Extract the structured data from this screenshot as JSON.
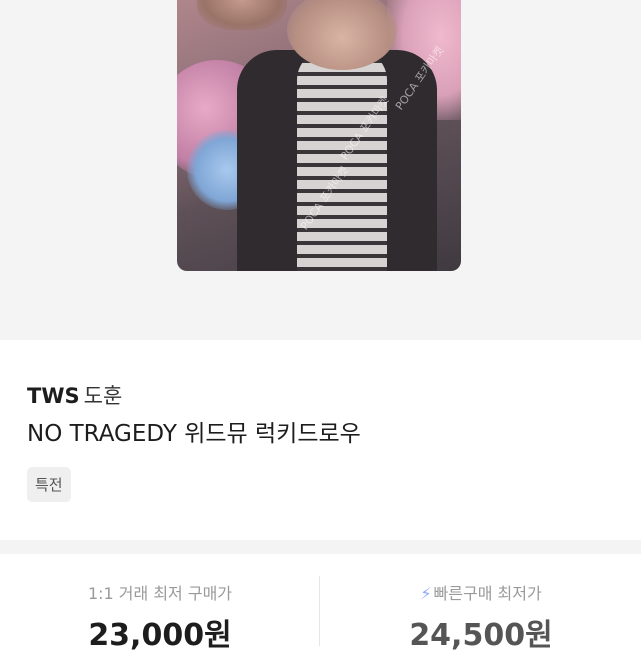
{
  "product": {
    "artist": "TWS",
    "member": "도훈",
    "title": "NO TRAGEDY 위드뮤 럭키드로우",
    "tag": "특전",
    "watermark": "POCA 포카마켓",
    "photo_icon": "photo-card-image"
  },
  "prices": {
    "direct_label": "1:1 거래 최저 구매가",
    "direct_value": "23,000원",
    "quick_label": "빠른구매 최저가",
    "quick_value": "24,500원",
    "quick_icon": "lightning-icon"
  },
  "colors": {
    "hero_bg": "#f4f4f5",
    "bolt": "#8ea9f5"
  }
}
